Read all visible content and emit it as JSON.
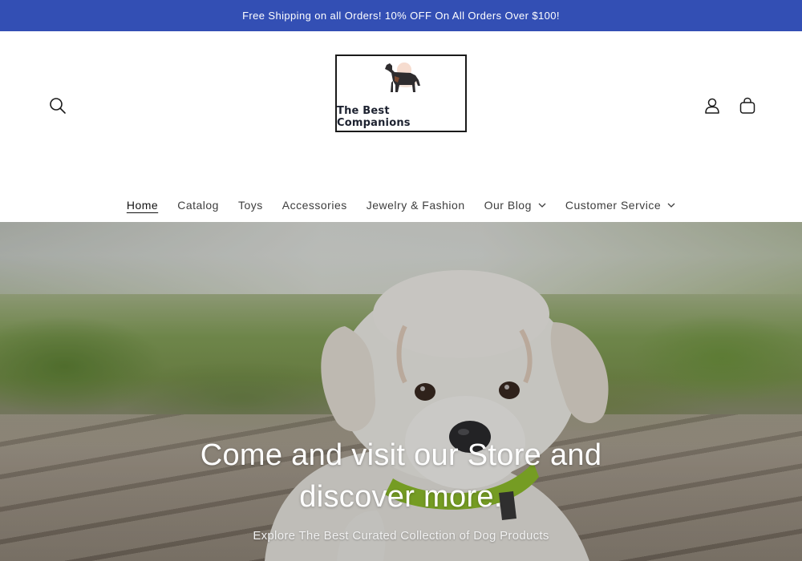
{
  "announcement": {
    "text": "Free Shipping on all Orders! 10% OFF On All Orders Over $100!",
    "background": "#334fb4"
  },
  "header": {
    "logo_text": "The Best  Companions",
    "icons": {
      "search": "search-icon",
      "account": "account-icon",
      "cart": "cart-icon"
    }
  },
  "nav": {
    "items": [
      {
        "label": "Home",
        "active": true
      },
      {
        "label": "Catalog"
      },
      {
        "label": "Toys"
      },
      {
        "label": "Accessories"
      },
      {
        "label": "Jewelry & Fashion"
      },
      {
        "label": "Our Blog",
        "dropdown": true
      },
      {
        "label": "Customer Service",
        "dropdown": true
      }
    ]
  },
  "hero": {
    "heading": "Come and visit our Store and discover more.",
    "subheading": "Explore The Best Curated Collection of Dog Products"
  }
}
